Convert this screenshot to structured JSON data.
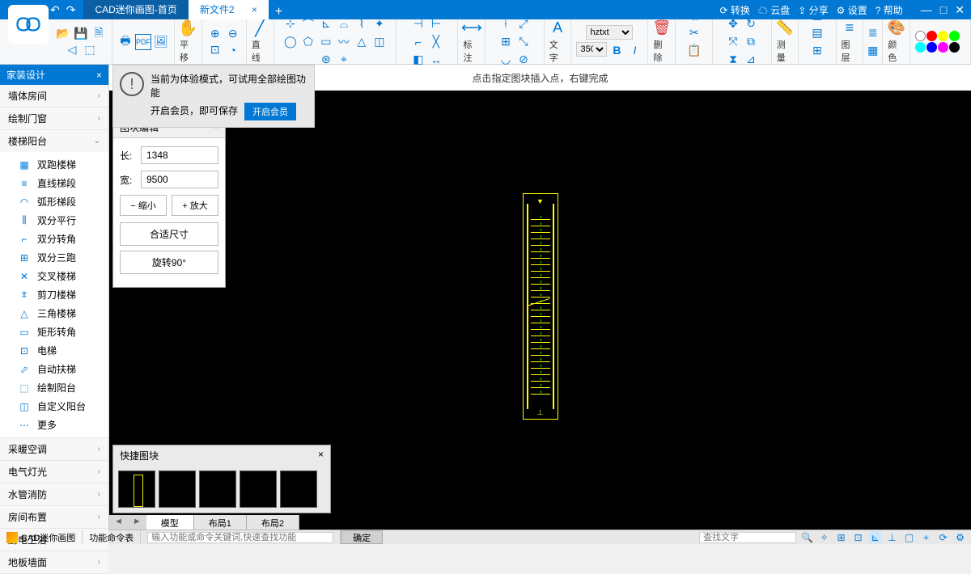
{
  "titlebar": {
    "tab_home": "CAD迷你画图-首页",
    "tab_active": "新文件2",
    "right": {
      "convert": "转换",
      "cloud": "云盘",
      "share": "分享",
      "settings": "设置",
      "help": "帮助"
    }
  },
  "ribbon": {
    "pan": "平移",
    "line": "直线",
    "annotate": "标注",
    "text": "文字",
    "font_name": "hztxt",
    "font_size": "350",
    "delete": "删除",
    "measure": "测量",
    "layer": "图层",
    "color": "颜色"
  },
  "sidepanel": {
    "title": "家装设计",
    "sections": {
      "walls": "墙体房间",
      "doors": "绘制门窗",
      "stairs": "楼梯阳台",
      "hvac": "采暖空调",
      "elec": "电气灯光",
      "water": "水管消防",
      "room": "房间布置",
      "kitchen": "厨电卫浴",
      "floor": "地板墙面"
    },
    "stair_items": {
      "i0": "双跑楼梯",
      "i1": "直线梯段",
      "i2": "弧形梯段",
      "i3": "双分平行",
      "i4": "双分转角",
      "i5": "双分三跑",
      "i6": "交叉楼梯",
      "i7": "剪刀楼梯",
      "i8": "三角楼梯",
      "i9": "矩形转角",
      "i10": "电梯",
      "i11": "自动扶梯",
      "i12": "绘制阳台",
      "i13": "自定义阳台",
      "i14": "更多"
    }
  },
  "hint": "点击指定图块插入点，右键完成",
  "notice": {
    "line1": "当前为体验模式，可试用全部绘图功能",
    "line2": "开启会员，即可保存",
    "btn": "开启会员"
  },
  "block_panel": {
    "title": "图块编辑",
    "len_label": "长:",
    "len_value": "1348",
    "wid_label": "宽:",
    "wid_value": "9500",
    "zoom_out": "缩小",
    "zoom_in": "放大",
    "fit": "合适尺寸",
    "rotate": "旋转90°"
  },
  "quick_panel": {
    "title": "快捷图块"
  },
  "canvas_tabs": {
    "model": "模型",
    "layout1": "布局1",
    "layout2": "布局2"
  },
  "statusbar": {
    "app": "CAD迷你画图",
    "cmd_label": "功能命令表",
    "cmd_placeholder": "输入功能或命令关键词,快速查找功能",
    "ok": "确定",
    "search_placeholder": "查找文字"
  },
  "colors": [
    "#ffffff",
    "#ff0000",
    "#ffff00",
    "#00ff00",
    "#00ffff",
    "#0000ff",
    "#ff00ff",
    "#000000",
    "#808080",
    "#404040"
  ]
}
